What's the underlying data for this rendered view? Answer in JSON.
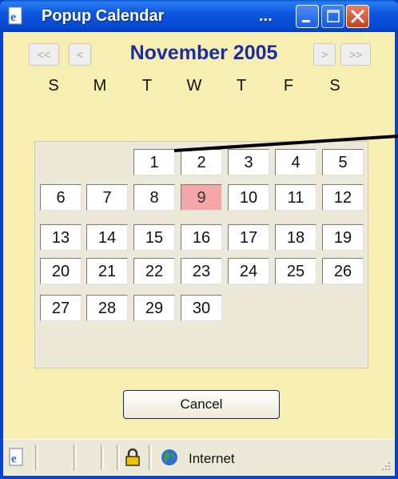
{
  "window": {
    "title": "Popup Calendar",
    "title_suffix": "...",
    "buttons": [
      "minimize",
      "maximize",
      "close"
    ]
  },
  "calendar": {
    "nav": {
      "prev_year": "<<",
      "prev_month": "<",
      "next_month": ">",
      "next_year": ">>"
    },
    "month_label": "November 2005",
    "weekdays": [
      "S",
      "M",
      "T",
      "W",
      "T",
      "F",
      "S"
    ],
    "today": "9",
    "days": [
      "1",
      "2",
      "3",
      "4",
      "5",
      "6",
      "7",
      "8",
      "9",
      "10",
      "11",
      "12",
      "13",
      "14",
      "15",
      "16",
      "17",
      "18",
      "19",
      "20",
      "21",
      "22",
      "23",
      "24",
      "25",
      "26",
      "27",
      "28",
      "29",
      "30"
    ],
    "first_weekday_index": 2
  },
  "actions": {
    "cancel_label": "Cancel"
  },
  "statusbar": {
    "zone_text": "Internet"
  },
  "colors": {
    "title_text": "#1d2ca0",
    "today_bg": "#f4a7a7",
    "panel_bg": "#f7eeb2"
  }
}
